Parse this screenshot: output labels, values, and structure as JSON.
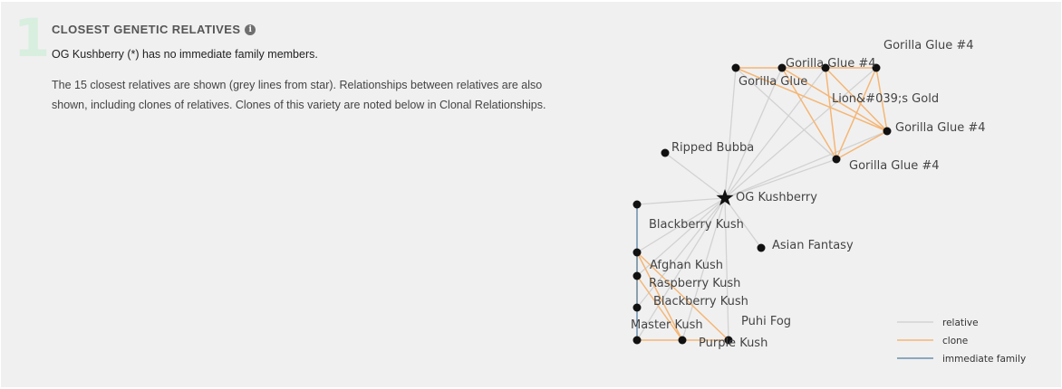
{
  "section": {
    "step": "1",
    "heading": "CLOSEST GENETIC RELATIVES",
    "info_icon": "info-icon",
    "lead": "OG Kushberry (*) has no immediate family members.",
    "description": "The 15 closest relatives are shown (grey lines from star). Relationships between relatives are also shown, including clones of relatives. Clones of this variety are noted below in Clonal Relationships."
  },
  "colors": {
    "relative": "#d2d2d2",
    "clone": "#f5b675",
    "immediate_family": "#6b8fae"
  },
  "graph": {
    "focus": "OG Kushberry",
    "nodes": [
      {
        "id": "center",
        "label": "OG Kushberry"
      },
      {
        "id": "gg1",
        "label": "Gorilla Glue"
      },
      {
        "id": "gg2",
        "label": "Gorilla Glue #4"
      },
      {
        "id": "gg3",
        "label": ""
      },
      {
        "id": "gg4",
        "label": "Gorilla Glue #4"
      },
      {
        "id": "lion",
        "label": "Lion&#039;s Gold"
      },
      {
        "id": "gg5",
        "label": "Gorilla Glue #4"
      },
      {
        "id": "gg6",
        "label": "Gorilla Glue #4"
      },
      {
        "id": "ripped",
        "label": "Ripped Bubba"
      },
      {
        "id": "bbk1",
        "label": "Blackberry Kush"
      },
      {
        "id": "asian",
        "label": "Asian Fantasy"
      },
      {
        "id": "afghan",
        "label": "Afghan Kush"
      },
      {
        "id": "rasp",
        "label": "Raspberry Kush"
      },
      {
        "id": "bbk2",
        "label": "Blackberry Kush"
      },
      {
        "id": "master",
        "label": "Master Kush"
      },
      {
        "id": "n_mid",
        "label": ""
      },
      {
        "id": "purple",
        "label": "Purple Kush"
      },
      {
        "id": "puhi",
        "label": "Puhi Fog"
      }
    ],
    "edges": [
      {
        "from": "center",
        "to": "gg1",
        "type": "relative"
      },
      {
        "from": "center",
        "to": "gg2",
        "type": "relative"
      },
      {
        "from": "center",
        "to": "gg3",
        "type": "relative"
      },
      {
        "from": "center",
        "to": "gg4",
        "type": "relative"
      },
      {
        "from": "center",
        "to": "gg5",
        "type": "relative"
      },
      {
        "from": "center",
        "to": "gg6",
        "type": "relative"
      },
      {
        "from": "center",
        "to": "ripped",
        "type": "relative"
      },
      {
        "from": "center",
        "to": "bbk1",
        "type": "relative"
      },
      {
        "from": "center",
        "to": "asian",
        "type": "relative"
      },
      {
        "from": "center",
        "to": "afghan",
        "type": "relative"
      },
      {
        "from": "center",
        "to": "rasp",
        "type": "relative"
      },
      {
        "from": "center",
        "to": "bbk2",
        "type": "relative"
      },
      {
        "from": "center",
        "to": "master",
        "type": "relative"
      },
      {
        "from": "center",
        "to": "n_mid",
        "type": "relative"
      },
      {
        "from": "center",
        "to": "purple",
        "type": "relative"
      },
      {
        "from": "gg1",
        "to": "gg6",
        "type": "relative"
      },
      {
        "from": "gg1",
        "to": "gg2",
        "type": "clone"
      },
      {
        "from": "gg2",
        "to": "gg3",
        "type": "clone"
      },
      {
        "from": "gg3",
        "to": "gg4",
        "type": "clone"
      },
      {
        "from": "gg1",
        "to": "gg5",
        "type": "clone"
      },
      {
        "from": "gg2",
        "to": "gg5",
        "type": "clone"
      },
      {
        "from": "gg3",
        "to": "gg5",
        "type": "clone"
      },
      {
        "from": "gg4",
        "to": "gg5",
        "type": "clone"
      },
      {
        "from": "gg2",
        "to": "gg6",
        "type": "clone"
      },
      {
        "from": "gg3",
        "to": "gg6",
        "type": "clone"
      },
      {
        "from": "gg4",
        "to": "gg6",
        "type": "clone"
      },
      {
        "from": "gg5",
        "to": "gg6",
        "type": "clone"
      },
      {
        "from": "bbk1",
        "to": "afghan",
        "type": "immediate_family"
      },
      {
        "from": "afghan",
        "to": "rasp",
        "type": "immediate_family"
      },
      {
        "from": "rasp",
        "to": "bbk2",
        "type": "immediate_family"
      },
      {
        "from": "bbk2",
        "to": "master",
        "type": "immediate_family"
      },
      {
        "from": "afghan",
        "to": "bbk2",
        "type": "clone"
      },
      {
        "from": "afghan",
        "to": "n_mid",
        "type": "clone"
      },
      {
        "from": "afghan",
        "to": "purple",
        "type": "clone"
      },
      {
        "from": "rasp",
        "to": "n_mid",
        "type": "clone"
      },
      {
        "from": "master",
        "to": "n_mid",
        "type": "clone"
      },
      {
        "from": "n_mid",
        "to": "purple",
        "type": "clone"
      }
    ]
  },
  "legend": [
    {
      "key": "relative",
      "label": "relative"
    },
    {
      "key": "clone",
      "label": "clone"
    },
    {
      "key": "immediate_family",
      "label": "immediate family"
    }
  ]
}
